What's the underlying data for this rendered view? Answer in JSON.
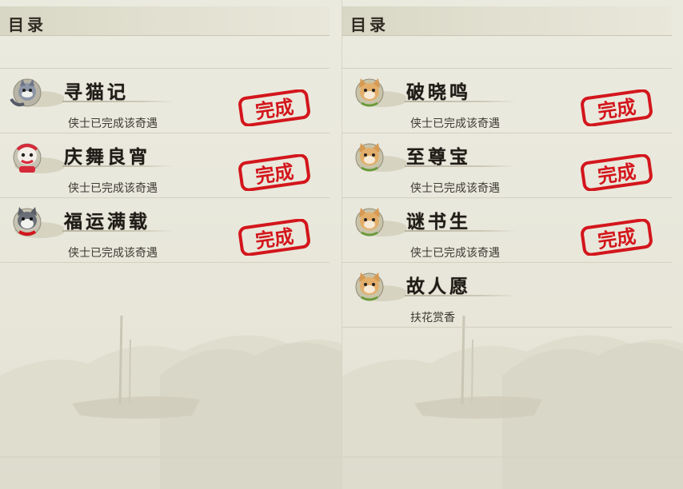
{
  "left_panel": {
    "header": {
      "title": "目录"
    },
    "items": [
      {
        "title": "寻猫记",
        "status": "侠士已完成该奇遇",
        "avatar_icon": "raccoon-cat-icon",
        "completed": true,
        "stamp_text": "完成"
      },
      {
        "title": "庆舞良宵",
        "status": "侠士已完成该奇遇",
        "avatar_icon": "lion-dance-icon",
        "completed": true,
        "stamp_text": "完成"
      },
      {
        "title": "福运满载",
        "status": "侠士已完成该奇遇",
        "avatar_icon": "husky-dog-icon",
        "completed": true,
        "stamp_text": "完成"
      }
    ]
  },
  "right_panel": {
    "header": {
      "title": "目录"
    },
    "items": [
      {
        "title": "破晓鸣",
        "status": "侠士已完成该奇遇",
        "avatar_icon": "fox-cat-icon",
        "completed": true,
        "stamp_text": "完成"
      },
      {
        "title": "至尊宝",
        "status": "侠士已完成该奇遇",
        "avatar_icon": "fox-cat-icon",
        "completed": true,
        "stamp_text": "完成"
      },
      {
        "title": "谜书生",
        "status": "侠士已完成该奇遇",
        "avatar_icon": "fox-cat-icon",
        "completed": true,
        "stamp_text": "完成"
      },
      {
        "title": "故人愿",
        "status": "扶花赏香",
        "avatar_icon": "fox-cat-icon",
        "completed": false,
        "stamp_text": ""
      }
    ]
  },
  "colors": {
    "stamp_red": "#d3161c",
    "ink_text": "#1f1c17",
    "paper": "#e9e8dc"
  }
}
